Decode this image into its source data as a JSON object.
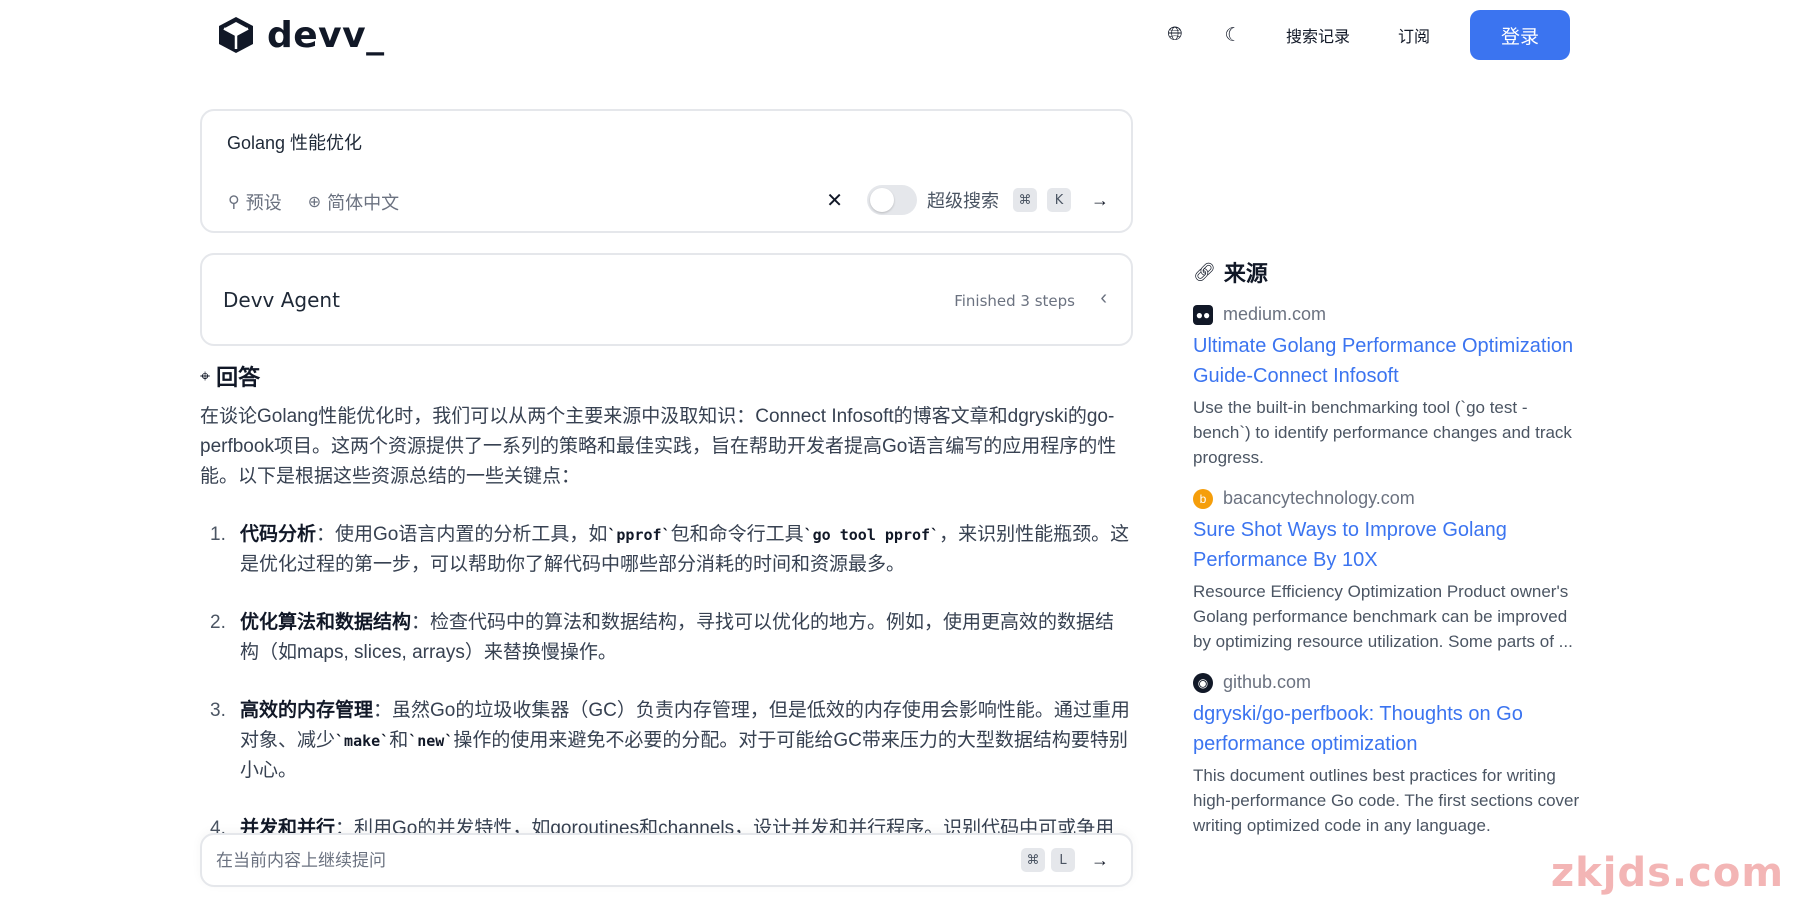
{
  "header": {
    "logo_text": "devv_",
    "nav": {
      "history": "搜索记录",
      "subscribe": "订阅",
      "login": "登录"
    }
  },
  "query": {
    "text": "Golang 性能优化",
    "preset_label": "预设",
    "language_label": "简体中文",
    "super_search_label": "超级搜索",
    "kbd_cmd": "⌘",
    "kbd_key": "K"
  },
  "agent": {
    "title": "Devv Agent",
    "status": "Finished 3 steps"
  },
  "answer": {
    "title": "回答",
    "intro": "在谈论Golang性能优化时，我们可以从两个主要来源中汲取知识：Connect Infosoft的博客文章和dgryski的go-perfbook项目。这两个资源提供了一系列的策略和最佳实践，旨在帮助开发者提高Go语言编写的应用程序的性能。以下是根据这些资源总结的一些关键点：",
    "items": [
      {
        "num": "1.",
        "title": "代码分析",
        "p1": "：使用Go语言内置的分析工具，如",
        "c1": "`pprof`",
        "p2": "包和命令行工具",
        "c2": "`go tool pprof`",
        "p3": "，来识别性能瓶颈。这是优化过程的第一步，可以帮助你了解代码中哪些部分消耗的时间和资源最多。"
      },
      {
        "num": "2.",
        "title": "优化算法和数据结构",
        "body": "：检查代码中的算法和数据结构，寻找可以优化的地方。例如，使用更高效的数据结构（如maps, slices, arrays）来替换慢操作。"
      },
      {
        "num": "3.",
        "title": "高效的内存管理",
        "p1": "：虽然Go的垃圾收集器（GC）负责内存管理，但是低效的内存使用会影响性能。通过重用对象、减少",
        "c1": "`make`",
        "p2": "和",
        "c2": "`new`",
        "p3": "操作的使用来避免不必要的分配。对于可能给GC带来压力的大型数据结构要特别小心。"
      },
      {
        "num": "4.",
        "title": "并发和并行",
        "body": "：利用Go的并发特性，如goroutines和channels，设计并发和并行程序。识别代码中可或争用可能会引入性能开销。"
      }
    ]
  },
  "followup": {
    "placeholder": "在当前内容上继续提问",
    "kbd_cmd": "⌘",
    "kbd_key": "L"
  },
  "sources": {
    "title": "来源",
    "items": [
      {
        "domain": "medium.com",
        "title": "Ultimate Golang Performance Optimization Guide-Connect Infosoft",
        "snippet": "Use the built-in benchmarking tool (`go test -bench`) to identify performance changes and track progress."
      },
      {
        "domain": "bacancytechnology.com",
        "title": "Sure Shot Ways to Improve Golang Performance By 10X",
        "snippet": "Resource Efficiency Optimization Product owner's Golang performance benchmark can be improved by optimizing resource utilization. Some parts of ..."
      },
      {
        "domain": "github.com",
        "title": "dgryski/go-perfbook: Thoughts on Go performance optimization",
        "snippet": "This document outlines best practices for writing high-performance Go code. The first sections cover writing optimized code in any language."
      }
    ]
  },
  "watermark": "zkjds.com",
  "colors": {
    "accent": "#3b74f0",
    "border": "#e5e7eb",
    "text": "#374151"
  }
}
